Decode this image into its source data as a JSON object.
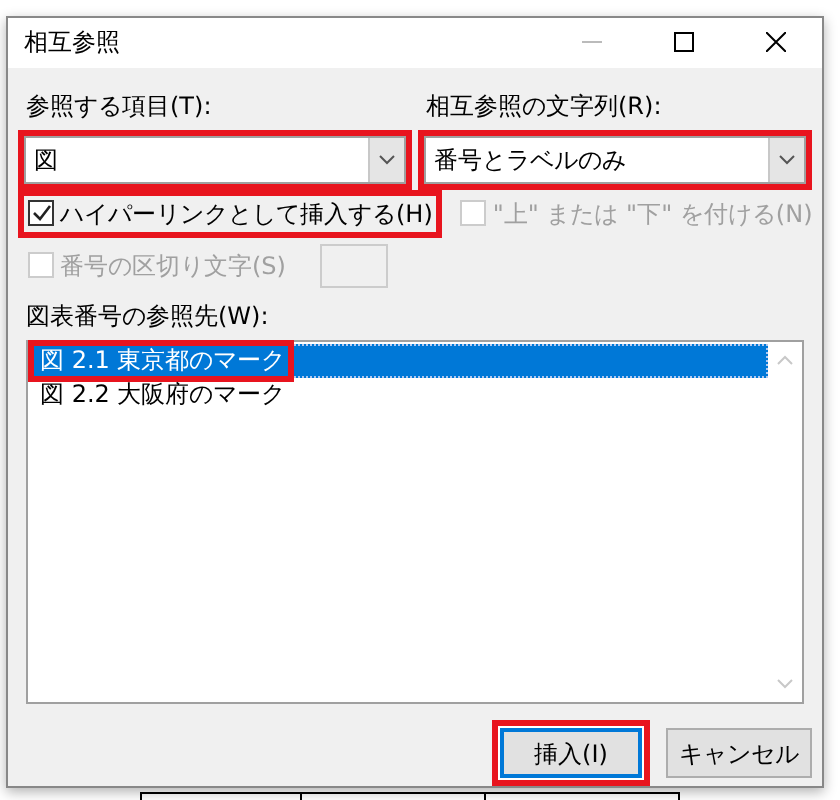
{
  "window": {
    "title": "相互参照"
  },
  "reference_type": {
    "label": "参照する項目(T):",
    "value": "図",
    "highlighted": true
  },
  "insert_reference_to": {
    "label": "相互参照の文字列(R):",
    "value": "番号とラベルのみ",
    "highlighted": true
  },
  "checkboxes": [
    {
      "label": "ハイパーリンクとして挿入する(H)",
      "checked": true,
      "disabled": false,
      "highlighted": true
    },
    {
      "label": "\"上\" または \"下\" を付ける(N)",
      "checked": false,
      "disabled": true,
      "highlighted": false
    },
    {
      "label": "番号の区切り文字(S)",
      "checked": false,
      "disabled": true,
      "highlighted": false,
      "kind": "with_field"
    }
  ],
  "caption_list": {
    "label": "図表番号の参照先(W):",
    "items": [
      {
        "text": "図 2.1  東京都のマーク",
        "selected": true,
        "highlighted": true
      },
      {
        "text": "図 2.2  大阪府のマーク",
        "selected": false,
        "highlighted": false
      }
    ]
  },
  "buttons": [
    {
      "label": "挿入(I)",
      "kind": "primary",
      "highlighted": true
    },
    {
      "label": "キャンセル",
      "kind": "secondary",
      "highlighted": false
    }
  ]
}
